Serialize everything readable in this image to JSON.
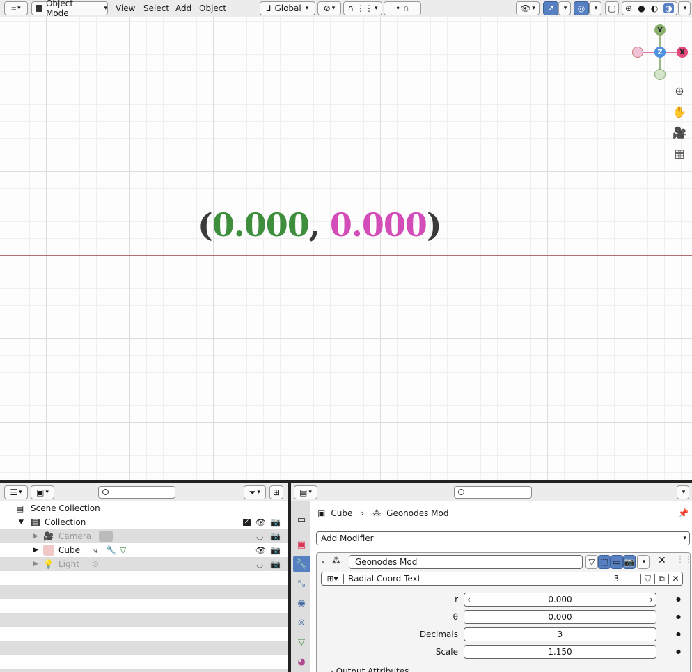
{
  "header": {
    "mode": "Object Mode",
    "menus": [
      "View",
      "Select",
      "Add",
      "Object"
    ],
    "orientation": "Global"
  },
  "viewport": {
    "coord_open": "(",
    "coord_x": "0.000",
    "coord_sep": ",",
    "coord_y": "0.000",
    "coord_close": ")",
    "gizmo": {
      "y": "Y",
      "z": "Z",
      "x": "X"
    }
  },
  "outliner": {
    "scene": "Scene Collection",
    "collection": "Collection",
    "items": [
      {
        "label": "Camera"
      },
      {
        "label": "Cube"
      },
      {
        "label": "Light"
      }
    ]
  },
  "properties": {
    "breadcrumb_object": "Cube",
    "breadcrumb_modifier": "Geonodes Mod",
    "add_modifier": "Add Modifier",
    "modifier_name": "Geonodes Mod",
    "node_group": "Radial Coord Text",
    "user_count": "3",
    "params": [
      {
        "label": "r",
        "value": "0.000"
      },
      {
        "label": "θ",
        "value": "0.000"
      },
      {
        "label": "Decimals",
        "value": "3"
      },
      {
        "label": "Scale",
        "value": "1.150"
      }
    ],
    "output_attributes": "Output Attributes"
  },
  "colors": {
    "x_green": "#3e8e3e",
    "y_magenta": "#d24db8",
    "accent": "#5680c2"
  }
}
